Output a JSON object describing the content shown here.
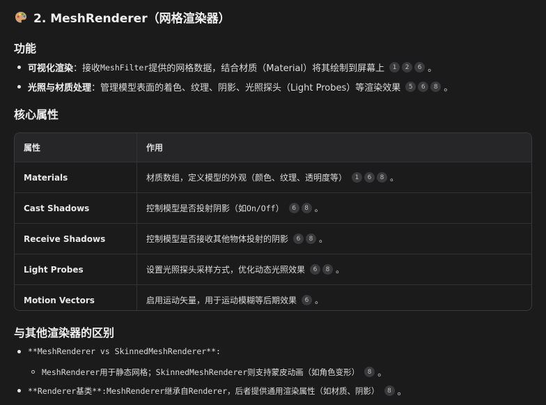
{
  "section": {
    "title": "2. MeshRenderer（网格渲染器）",
    "icon": "palette-icon"
  },
  "function": {
    "heading": "功能",
    "items": [
      {
        "label": "可视化渲染",
        "sep": "：",
        "t1": "接收",
        "code": "MeshFilter",
        "t2": "提供的网格数据，结合材质（Material）将其绘制到屏幕上",
        "refs": [
          "1",
          "2",
          "6"
        ],
        "end": "。"
      },
      {
        "label": "光照与材质处理",
        "sep": "：",
        "t1": "管理模型表面的着色、纹理、阴影、光照探头（Light Probes）等渲染效果",
        "refs": [
          "5",
          "6",
          "8"
        ],
        "end": "。"
      }
    ]
  },
  "core": {
    "heading": "核心属性",
    "table": {
      "headers": [
        "属性",
        "作用"
      ],
      "rows": [
        {
          "name": "Materials",
          "pre": "材质数组，定义模型的外观（颜色、纹理、透明度等）",
          "refs": [
            "1",
            "6",
            "8"
          ],
          "end": "。"
        },
        {
          "name": "Cast Shadows",
          "pre": "控制模型是否投射阴影（如",
          "code": "On/Off",
          "post": "）",
          "refs": [
            "6",
            "8"
          ],
          "end": "。"
        },
        {
          "name": "Receive Shadows",
          "pre": "控制模型是否接收其他物体投射的阴影",
          "refs": [
            "6",
            "8"
          ],
          "end": "。"
        },
        {
          "name": "Light Probes",
          "pre": "设置光照探头采样方式，优化动态光照效果",
          "refs": [
            "6",
            "8"
          ],
          "end": "。"
        },
        {
          "name": "Motion Vectors",
          "pre": "启用运动矢量，用于运动模糊等后期效果",
          "refs": [
            "6"
          ],
          "end": "。"
        }
      ]
    }
  },
  "diff": {
    "heading": "与其他渲染器的区别",
    "items": [
      {
        "text": "**MeshRenderer vs SkinnedMeshRenderer**:"
      },
      {
        "text": "MeshRenderer用于静态网格；SkinnedMeshRenderer则支持蒙皮动画（如角色变形）",
        "refs": [
          "8"
        ],
        "end": "。"
      },
      {
        "pre": "**Renderer基类**:",
        "text": " MeshRenderer继承自Renderer，后者提供通用渲染属性（如材质、阴影）",
        "refs": [
          "8"
        ],
        "end": "。"
      }
    ]
  }
}
